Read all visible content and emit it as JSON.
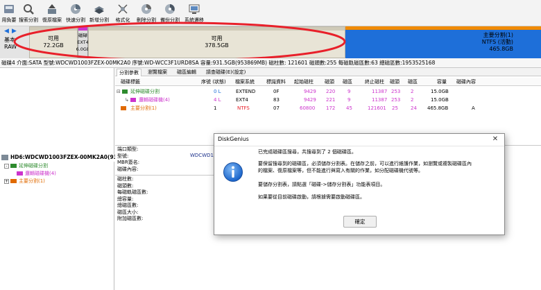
{
  "toolbar": {
    "items": [
      {
        "label": "用負要",
        "icon": "disk-icon"
      },
      {
        "label": "搜索分割",
        "icon": "search-icon"
      },
      {
        "label": "復原檔案",
        "icon": "restore-icon"
      },
      {
        "label": "快速分割",
        "icon": "quick-partition-icon"
      },
      {
        "label": "新增分割",
        "icon": "new-partition-icon"
      },
      {
        "label": "格式化",
        "icon": "format-icon"
      },
      {
        "label": "刪除分割",
        "icon": "delete-icon"
      },
      {
        "label": "備份分割",
        "icon": "backup-icon"
      },
      {
        "label": "系統遷移",
        "icon": "migrate-icon"
      }
    ]
  },
  "diskmap": {
    "left_label_top": "基本",
    "left_label_bottom": "RAW",
    "segments": [
      {
        "line1": "可用",
        "line2": "72.2GB"
      },
      {
        "line1": "磁碌",
        "line2": "EXT4",
        "line3": "6.0GB"
      },
      {
        "line1": "可用",
        "line2": "378.5GB"
      },
      {
        "line1": "主要分割(1)",
        "line2": "NTFS (活動)",
        "line3": "465.8GB"
      }
    ]
  },
  "infobar": {
    "text": "磁碟4 介面:SATA 型號:WDCWD1003FZEX-00MK2A0 序號:WD-WCC3F1URD8SA 容量:931.5GB(953869MB) 磁柱數: 121601 磁頭數:255 每磁軌磁區數:63 總磁區數:1953525168"
  },
  "tree": {
    "disk": "HD6:WDCWD1003FZEX-00MK2A0(932",
    "items": [
      {
        "label": "延伸磁碟分割"
      },
      {
        "label": "邏輯磁碟機(4)"
      },
      {
        "label": "主要分割(1)"
      }
    ]
  },
  "tabs": [
    "分割參數",
    "瀏覽檔案",
    "磁區編輯",
    "請查磁碟(E)(設定)"
  ],
  "table": {
    "headers": [
      "磁碟標籤",
      "序號 (狀態)",
      "檔案系統",
      "標識資料",
      "起始磁柱",
      "磁頭",
      "磁區",
      "終止磁柱",
      "磁頭",
      "磁區",
      "容量",
      "磁碟內容"
    ],
    "rows": [
      [
        "延伸磁碟分割",
        "0 L",
        "EXTEND",
        "0F",
        "9429",
        "220",
        "9",
        "11387",
        "253",
        "2",
        "15.0GB",
        ""
      ],
      [
        "邏輯磁碟機(4)",
        "4 L",
        "EXT4",
        "83",
        "9429",
        "221",
        "9",
        "11387",
        "253",
        "2",
        "15.0GB",
        ""
      ],
      [
        "主要分割(1)",
        "1",
        "NTFS",
        "07",
        "60800",
        "172",
        "45",
        "121601",
        "25",
        "24",
        "465.8GB",
        "A"
      ]
    ]
  },
  "details": {
    "labels_top": [
      "端口類型:",
      "型號:",
      "MBR簽名:",
      "磁碟內容:"
    ],
    "model_value": "WDCWD1",
    "labels_bottom": [
      "磁柱數:",
      "磁頭數:",
      "每磁軌磁區數:",
      "總容量:",
      "總磁區數:",
      "磁區大小:",
      "附加磁區數:"
    ]
  },
  "dialog": {
    "title": "DiskGenius",
    "lines": [
      "已完成磁碟區搜尋，共搜尋到了 2 個磁碟區。",
      "要保留搜尋到的磁碟區，必須儲存分割表。在儲存之前，可以進行維護作業，如瀏覽或複製磁碟區內",
      "的檔案、復原檔案等，但不能進行與寫入有關的作業，如分配磁碟機代號等。",
      "要儲存分割表，請點選「磁碟->儲存分割表」功能表項目。",
      "如果要從目前磁碟啟動，請根據需要啟動磁碟區。"
    ],
    "ok_label": "確定",
    "close_label": "✕"
  },
  "colors": {
    "red_ring": "#e8202a",
    "primary_blue": "#1e6fd9",
    "logical_magenta": "#cc33cc",
    "extend_green": "#2e8b2e",
    "primary_orange": "#e06a00",
    "free_grey": "#e6e2d4"
  }
}
